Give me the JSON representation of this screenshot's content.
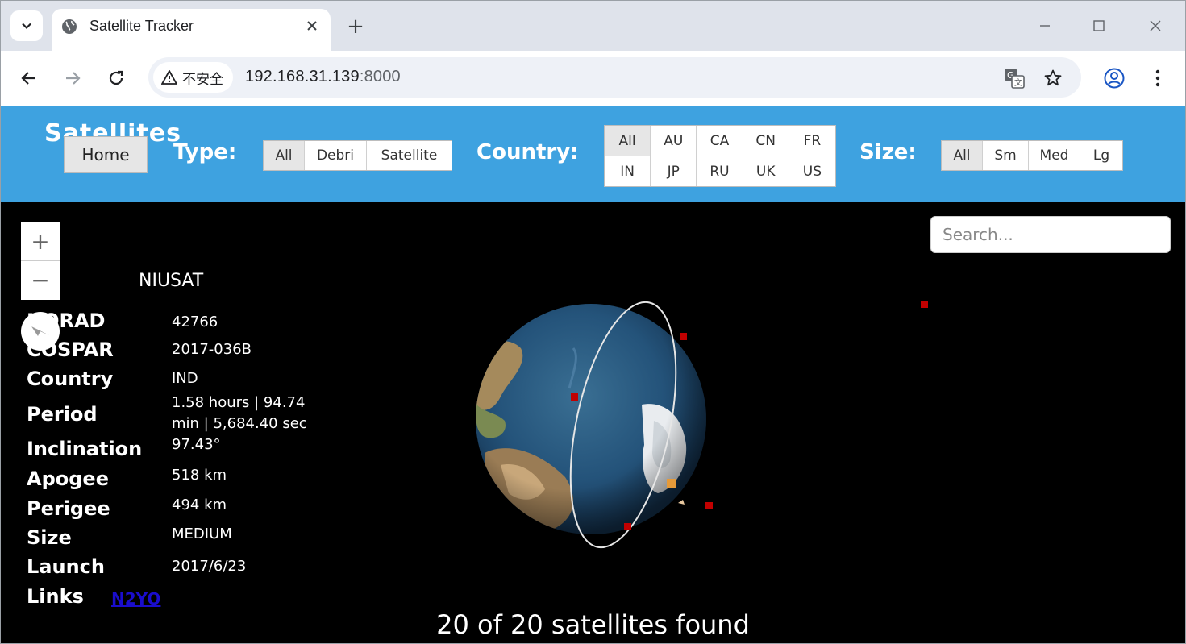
{
  "browser": {
    "tab_title": "Satellite Tracker",
    "new_tab": "+",
    "security_label": "不安全",
    "url_host": "192.168.31.139",
    "url_port": ":8000"
  },
  "header": {
    "brand": "Satellites",
    "home_label": "Home",
    "type_label": "Type:",
    "type_options": [
      "All",
      "Debri",
      "Satellite"
    ],
    "country_label": "Country:",
    "country_options": [
      "All",
      "AU",
      "CA",
      "CN",
      "FR",
      "IN",
      "JP",
      "RU",
      "UK",
      "US"
    ],
    "size_label": "Size:",
    "size_options": [
      "All",
      "Sm",
      "Med",
      "Lg"
    ]
  },
  "search": {
    "placeholder": "Search..."
  },
  "map": {
    "zoom_in": "+",
    "zoom_out": "−"
  },
  "satellite": {
    "name": "NIUSAT",
    "fields": [
      {
        "label": "NORAD",
        "value": "42766"
      },
      {
        "label": "COSPAR",
        "value": "2017-036B"
      },
      {
        "label": "Country",
        "value": "IND"
      },
      {
        "label": "Period",
        "value": "1.58 hours | 94.74 min | 5,684.40 sec"
      },
      {
        "label": "Inclination",
        "value": "97.43°"
      },
      {
        "label": "Apogee",
        "value": "518 km"
      },
      {
        "label": "Perigee",
        "value": "494 km"
      },
      {
        "label": "Size",
        "value": "MEDIUM"
      },
      {
        "label": "Launch",
        "value": "2017/6/23"
      },
      {
        "label": "Links",
        "value": ""
      }
    ],
    "link_text": "N2YO"
  },
  "status": {
    "found_text": "20 of 20 satellites found"
  },
  "colors": {
    "header_bg": "#3ea2e0",
    "page_bg": "#000000",
    "satellite_marker": "#c10000",
    "selected_marker": "#e59a3a"
  }
}
